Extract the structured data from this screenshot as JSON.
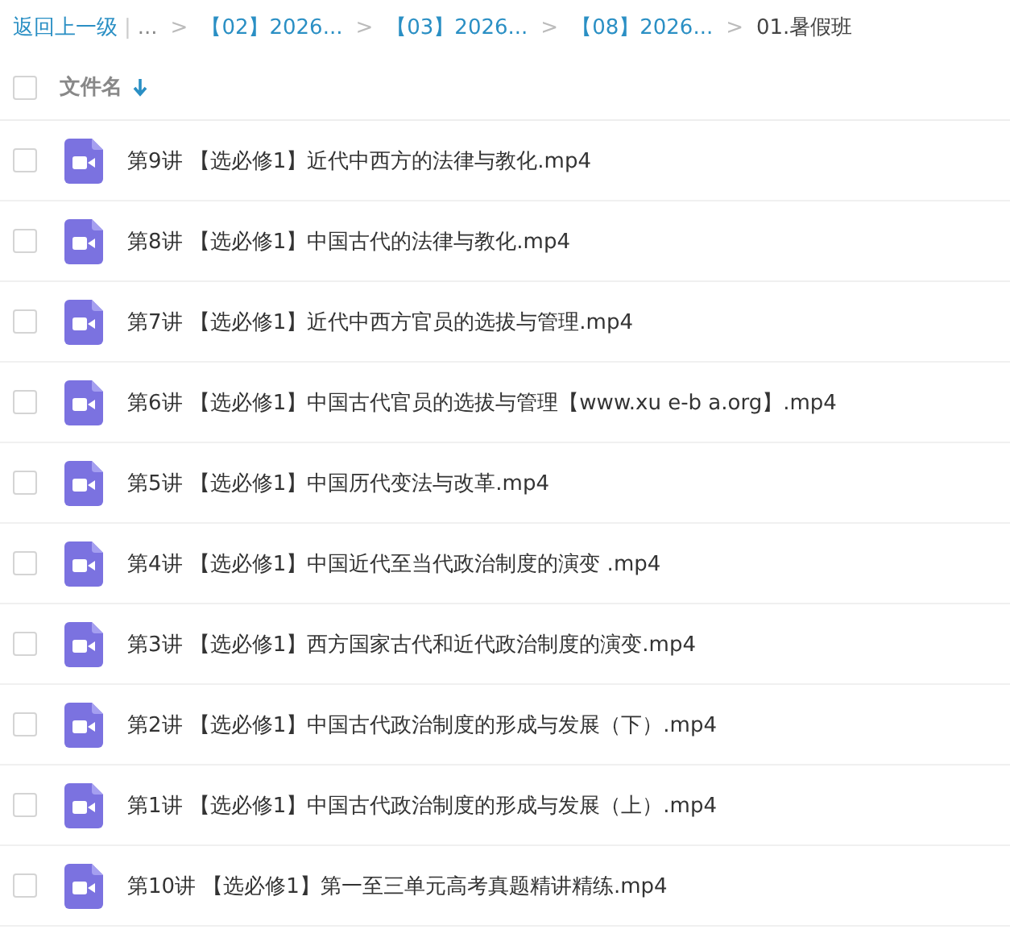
{
  "breadcrumb": {
    "back": "返回上一级",
    "divider": "|",
    "items": [
      {
        "text": "...",
        "kind": "ellipsis"
      },
      {
        "text": "【02】2026...",
        "kind": "link",
        "before": ">"
      },
      {
        "text": "【03】2026...",
        "kind": "link",
        "before": ">"
      },
      {
        "text": "【08】2026...",
        "kind": "link",
        "before": ">"
      },
      {
        "text": "01.暑假班",
        "kind": "current",
        "before": ">"
      }
    ]
  },
  "header": {
    "checked": false,
    "column": "文件名"
  },
  "files": [
    {
      "name": "第9讲 【选必修1】近代中西方的法律与教化.mp4",
      "checked": false
    },
    {
      "name": "第8讲 【选必修1】中国古代的法律与教化.mp4",
      "checked": false
    },
    {
      "name": "第7讲 【选必修1】近代中西方官员的选拔与管理.mp4",
      "checked": false
    },
    {
      "name": "第6讲 【选必修1】中国古代官员的选拔与管理【www.xu e-b a.org】.mp4",
      "checked": false
    },
    {
      "name": "第5讲 【选必修1】中国历代变法与改革.mp4",
      "checked": false
    },
    {
      "name": "第4讲 【选必修1】中国近代至当代政治制度的演变 .mp4",
      "checked": false
    },
    {
      "name": "第3讲 【选必修1】西方国家古代和近代政治制度的演变.mp4",
      "checked": false
    },
    {
      "name": "第2讲 【选必修1】中国古代政治制度的形成与发展（下）.mp4",
      "checked": false
    },
    {
      "name": "第1讲 【选必修1】中国古代政治制度的形成与发展（上）.mp4",
      "checked": false
    },
    {
      "name": "第10讲 【选必修1】第一至三单元高考真题精讲精练.mp4",
      "checked": false
    }
  ]
}
